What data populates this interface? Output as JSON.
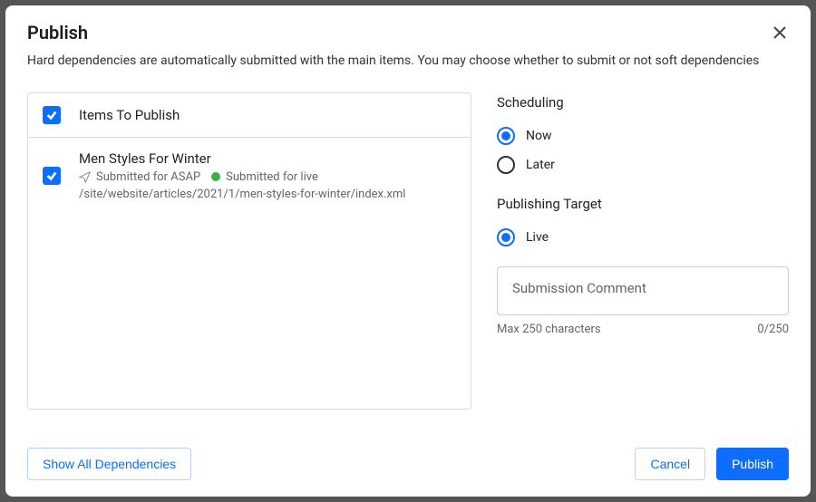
{
  "header": {
    "title": "Publish",
    "subtitle": "Hard dependencies are automatically submitted with the main items. You may choose whether to submit or not soft dependencies"
  },
  "itemsList": {
    "headerLabel": "Items To Publish",
    "items": [
      {
        "title": "Men Styles For Winter",
        "submittedAsap": "Submitted for ASAP",
        "submittedLive": "Submitted for live",
        "path": "/site/website/articles/2021/1/men-styles-for-winter/index.xml"
      }
    ]
  },
  "scheduling": {
    "label": "Scheduling",
    "options": {
      "now": "Now",
      "later": "Later"
    },
    "selected": "now"
  },
  "publishingTarget": {
    "label": "Publishing Target",
    "options": {
      "live": "Live"
    },
    "selected": "live"
  },
  "comment": {
    "placeholder": "Submission Comment",
    "maxHint": "Max 250 characters",
    "counter": "0/250"
  },
  "buttons": {
    "showAll": "Show All Dependencies",
    "cancel": "Cancel",
    "publish": "Publish"
  }
}
